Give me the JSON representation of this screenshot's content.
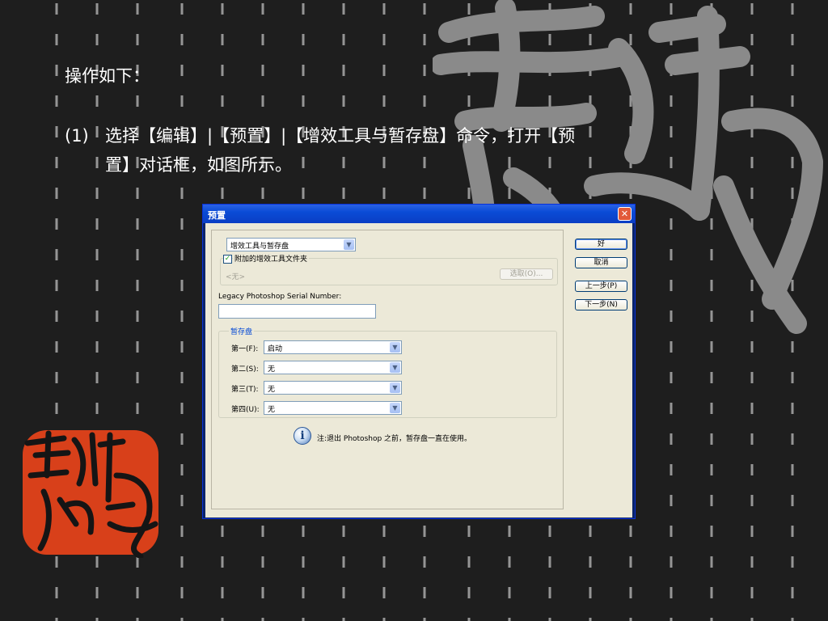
{
  "slide": {
    "intro": "操作如下：",
    "step_number": "(1)",
    "step_line1": "选择【编辑】|【预置】|【增效工具与暂存盘】命令，打开【预",
    "step_line2": "置】对话框，如图所示。"
  },
  "dialog": {
    "title": "预置",
    "close_glyph": "✕",
    "section_select": "增效工具与暂存盘",
    "plugins_checkbox_label": "附加的增效工具文件夹",
    "plugins_checked": true,
    "plugins_folder_value": "<无>",
    "choose_button": "选取(O)...",
    "serial_label": "Legacy Photoshop Serial Number:",
    "serial_value": "",
    "scratch_group_label": "暂存盘",
    "scratch_disks": [
      {
        "label": "第一(F):",
        "value": "启动"
      },
      {
        "label": "第二(S):",
        "value": "无"
      },
      {
        "label": "第三(T):",
        "value": "无"
      },
      {
        "label": "第四(U):",
        "value": "无"
      }
    ],
    "note": "注:退出 Photoshop 之前，暂存盘一直在使用。",
    "buttons": {
      "ok": "好",
      "cancel": "取消",
      "prev": "上一步(P)",
      "next": "下一步(N)"
    }
  },
  "colors": {
    "background": "#1e1e1e",
    "stripe": "#bdbdbd",
    "calligraphy": "#8a8a8a",
    "seal": "#d8401a",
    "dialog_face": "#ece9d8",
    "titlebar": "#0a4bd6"
  }
}
